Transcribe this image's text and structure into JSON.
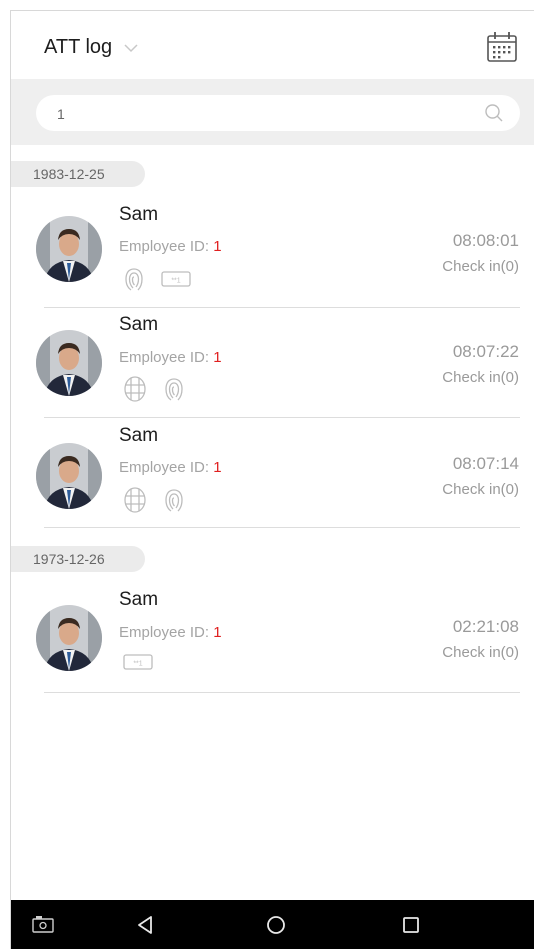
{
  "header": {
    "title": "ATT log"
  },
  "search": {
    "value": "1"
  },
  "groups": [
    {
      "date": "1983-12-25",
      "records": [
        {
          "name": "Sam",
          "emp_label": "Employee ID:",
          "emp_id": "1",
          "time": "08:08:01",
          "state": "Check in(0)",
          "verify": [
            "fingerprint-icon",
            "card-icon"
          ]
        },
        {
          "name": "Sam",
          "emp_label": "Employee ID:",
          "emp_id": "1",
          "time": "08:07:22",
          "state": "Check in(0)",
          "verify": [
            "face-icon",
            "fingerprint-icon"
          ]
        },
        {
          "name": "Sam",
          "emp_label": "Employee ID:",
          "emp_id": "1",
          "time": "08:07:14",
          "state": "Check in(0)",
          "verify": [
            "face-icon",
            "fingerprint-icon"
          ]
        }
      ]
    },
    {
      "date": "1973-12-26",
      "records": [
        {
          "name": "Sam",
          "emp_label": "Employee ID:",
          "emp_id": "1",
          "time": "02:21:08",
          "state": "Check in(0)",
          "verify": [
            "card-icon"
          ]
        }
      ]
    }
  ],
  "colors": {
    "accent_red": "#e02020",
    "text_dark": "#1e1e1e",
    "text_grey": "#9a9a9a",
    "band": "#efefef"
  },
  "navbar": {
    "icons": [
      "screenshot-icon",
      "back-icon",
      "home-icon",
      "recents-icon"
    ]
  }
}
